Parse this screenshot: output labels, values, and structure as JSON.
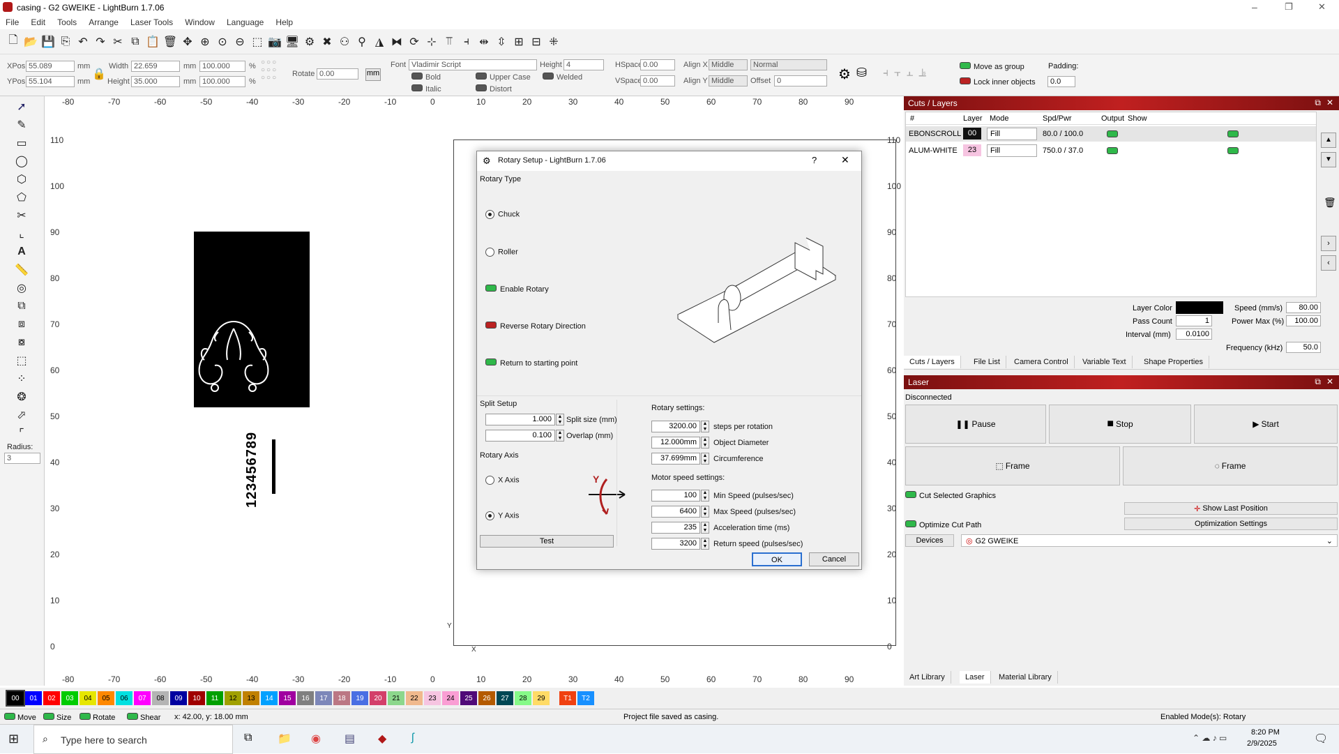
{
  "window": {
    "title": "casing - G2 GWEIKE - LightBurn 1.7.06",
    "controls": [
      "–",
      "❐",
      "✕"
    ]
  },
  "menu": [
    "File",
    "Edit",
    "Tools",
    "Arrange",
    "Laser Tools",
    "Window",
    "Language",
    "Help"
  ],
  "props": {
    "xpos_label": "XPos",
    "xpos": "55.089",
    "ypos_label": "YPos",
    "ypos": "55.104",
    "unit": "mm",
    "width_label": "Width",
    "width": "22.659",
    "height_label": "Height",
    "height": "35.000",
    "wpct": "100.000",
    "hpct": "100.000",
    "pct": "%",
    "rotate_label": "Rotate",
    "rotate": "0.00",
    "mm_btn": "mm",
    "font_label": "Font",
    "font": "Vladimir Script",
    "fheight_label": "Height",
    "fheight": "4",
    "hspace_label": "HSpace",
    "hspace": "0.00",
    "vspace_label": "VSpace",
    "vspace": "0.00",
    "alignx_label": "Align X",
    "alignx": "Middle",
    "aligny_label": "Align Y",
    "aligny": "Middle",
    "normal": "Normal",
    "offset_label": "Offset",
    "offset": "0",
    "bold": "Bold",
    "italic": "Italic",
    "upper": "Upper Case",
    "distort": "Distort",
    "welded": "Welded",
    "move_group": "Move as group",
    "lock_inner": "Lock inner objects",
    "padding_label": "Padding:",
    "padding": "0.0"
  },
  "ruler": {
    "x": [
      "-80",
      "-70",
      "-60",
      "-50",
      "-40",
      "-30",
      "-20",
      "-10",
      "0",
      "10",
      "20",
      "30",
      "40",
      "50",
      "60",
      "70",
      "80",
      "90"
    ],
    "y": [
      "110",
      "100",
      "90",
      "80",
      "70",
      "60",
      "50",
      "40",
      "30",
      "20",
      "10",
      "0"
    ],
    "radius_label": "Radius:",
    "radius": "3",
    "x_axis": "X",
    "y_axis": "Y"
  },
  "canvas": {
    "vertical_text": "123456789"
  },
  "dialog": {
    "title": "Rotary Setup - LightBurn 1.7.06",
    "help": "?",
    "close": "✕",
    "rotary_type": "Rotary Type",
    "chuck": "Chuck",
    "roller": "Roller",
    "enable_rotary": "Enable Rotary",
    "reverse": "Reverse Rotary Direction",
    "return_start": "Return to starting point",
    "split_setup": "Split Setup",
    "split_size": "1.000",
    "split_size_label": "Split size (mm)",
    "overlap": "0.100",
    "overlap_label": "Overlap (mm)",
    "rotary_axis": "Rotary Axis",
    "x_axis": "X Axis",
    "y_axis": "Y Axis",
    "axis_glyph": "Y",
    "test": "Test",
    "rotary_settings": "Rotary settings:",
    "steps": "3200.00",
    "steps_label": "steps per rotation",
    "diameter": "12.000mm",
    "diameter_label": "Object Diameter",
    "circ": "37.699mm",
    "circ_label": "Circumference",
    "motor_settings": "Motor speed settings:",
    "min_speed": "100",
    "min_speed_label": "Min Speed (pulses/sec)",
    "max_speed": "6400",
    "max_speed_label": "Max Speed (pulses/sec)",
    "accel": "235",
    "accel_label": "Acceleration time (ms)",
    "return_speed": "3200",
    "return_speed_label": "Return speed (pulses/sec)",
    "ok": "OK",
    "cancel": "Cancel"
  },
  "cuts": {
    "title": "Cuts / Layers",
    "headers": [
      "#",
      "Layer",
      "Mode",
      "Spd/Pwr",
      "Output",
      "Show"
    ],
    "rows": [
      {
        "name": "EBONSCROLL",
        "layer": "00",
        "mode": "Fill",
        "spd": "80.0 / 100.0",
        "color": "#111111"
      },
      {
        "name": "ALUM-WHITE",
        "layer": "23",
        "mode": "Fill",
        "spd": "750.0 / 37.0",
        "color": "#f4b8d8"
      }
    ],
    "layer_color": "Layer Color",
    "pass_count": "Pass Count",
    "pass_val": "1",
    "interval": "Interval (mm)",
    "interval_val": "0.0100",
    "speed": "Speed (mm/s)",
    "speed_val": "80.00",
    "power": "Power Max (%)",
    "power_val": "100.00",
    "freq": "Frequency (kHz)",
    "freq_val": "50.0",
    "tabs": [
      "Cuts / Layers",
      "File List",
      "Camera Control",
      "Variable Text",
      "Shape Properties"
    ]
  },
  "laser": {
    "title": "Laser",
    "status": "Disconnected",
    "pause": "Pause",
    "stop": "Stop",
    "start": "Start",
    "frame1": "Frame",
    "frame2": "Frame",
    "cut_selected": "Cut Selected Graphics",
    "show_last": "Show Last Position",
    "optimize": "Optimize Cut Path",
    "opt_settings": "Optimization Settings",
    "devices": "Devices",
    "device": "G2 GWEIKE",
    "bottom_tabs": [
      "Art Library",
      "Laser",
      "Material Library"
    ]
  },
  "palette": [
    {
      "n": "00",
      "c": "#000000",
      "t": "#fff"
    },
    {
      "n": "01",
      "c": "#0000ff",
      "t": "#fff"
    },
    {
      "n": "02",
      "c": "#ff0000",
      "t": "#fff"
    },
    {
      "n": "03",
      "c": "#00cc00",
      "t": "#fff"
    },
    {
      "n": "04",
      "c": "#e6e600",
      "t": "#000"
    },
    {
      "n": "05",
      "c": "#ff8800",
      "t": "#000"
    },
    {
      "n": "06",
      "c": "#00e0e0",
      "t": "#000"
    },
    {
      "n": "07",
      "c": "#ff00ff",
      "t": "#fff"
    },
    {
      "n": "08",
      "c": "#b4b4b4",
      "t": "#000"
    },
    {
      "n": "09",
      "c": "#0000a0",
      "t": "#fff"
    },
    {
      "n": "10",
      "c": "#a00000",
      "t": "#fff"
    },
    {
      "n": "11",
      "c": "#00a000",
      "t": "#fff"
    },
    {
      "n": "12",
      "c": "#a0a000",
      "t": "#000"
    },
    {
      "n": "13",
      "c": "#c08000",
      "t": "#000"
    },
    {
      "n": "14",
      "c": "#00a0ff",
      "t": "#fff"
    },
    {
      "n": "15",
      "c": "#a000a0",
      "t": "#fff"
    },
    {
      "n": "16",
      "c": "#808080",
      "t": "#fff"
    },
    {
      "n": "17",
      "c": "#7d87b9",
      "t": "#fff"
    },
    {
      "n": "18",
      "c": "#bb7784",
      "t": "#fff"
    },
    {
      "n": "19",
      "c": "#4a6fe3",
      "t": "#fff"
    },
    {
      "n": "20",
      "c": "#d33f6a",
      "t": "#fff"
    },
    {
      "n": "21",
      "c": "#8cd78c",
      "t": "#000"
    },
    {
      "n": "22",
      "c": "#f0b98d",
      "t": "#000"
    },
    {
      "n": "23",
      "c": "#f6c4e1",
      "t": "#000"
    },
    {
      "n": "24",
      "c": "#fa9ed4",
      "t": "#000"
    },
    {
      "n": "25",
      "c": "#500a78",
      "t": "#fff"
    },
    {
      "n": "26",
      "c": "#b45a00",
      "t": "#fff"
    },
    {
      "n": "27",
      "c": "#004754",
      "t": "#fff"
    },
    {
      "n": "28",
      "c": "#86fa88",
      "t": "#000"
    },
    {
      "n": "29",
      "c": "#ffdb66",
      "t": "#000"
    },
    {
      "n": "T1",
      "c": "#f04010",
      "t": "#fff"
    },
    {
      "n": "T2",
      "c": "#1890ff",
      "t": "#fff"
    }
  ],
  "status": {
    "move": "Move",
    "size": "Size",
    "rotate": "Rotate",
    "shear": "Shear",
    "coords": "x: 42.00, y: 18.00 mm",
    "msg": "Project file saved as casing.",
    "mode": "Enabled Mode(s): Rotary"
  },
  "taskbar": {
    "search": "Type here to search",
    "time": "8:20 PM",
    "date": "2/9/2025"
  }
}
